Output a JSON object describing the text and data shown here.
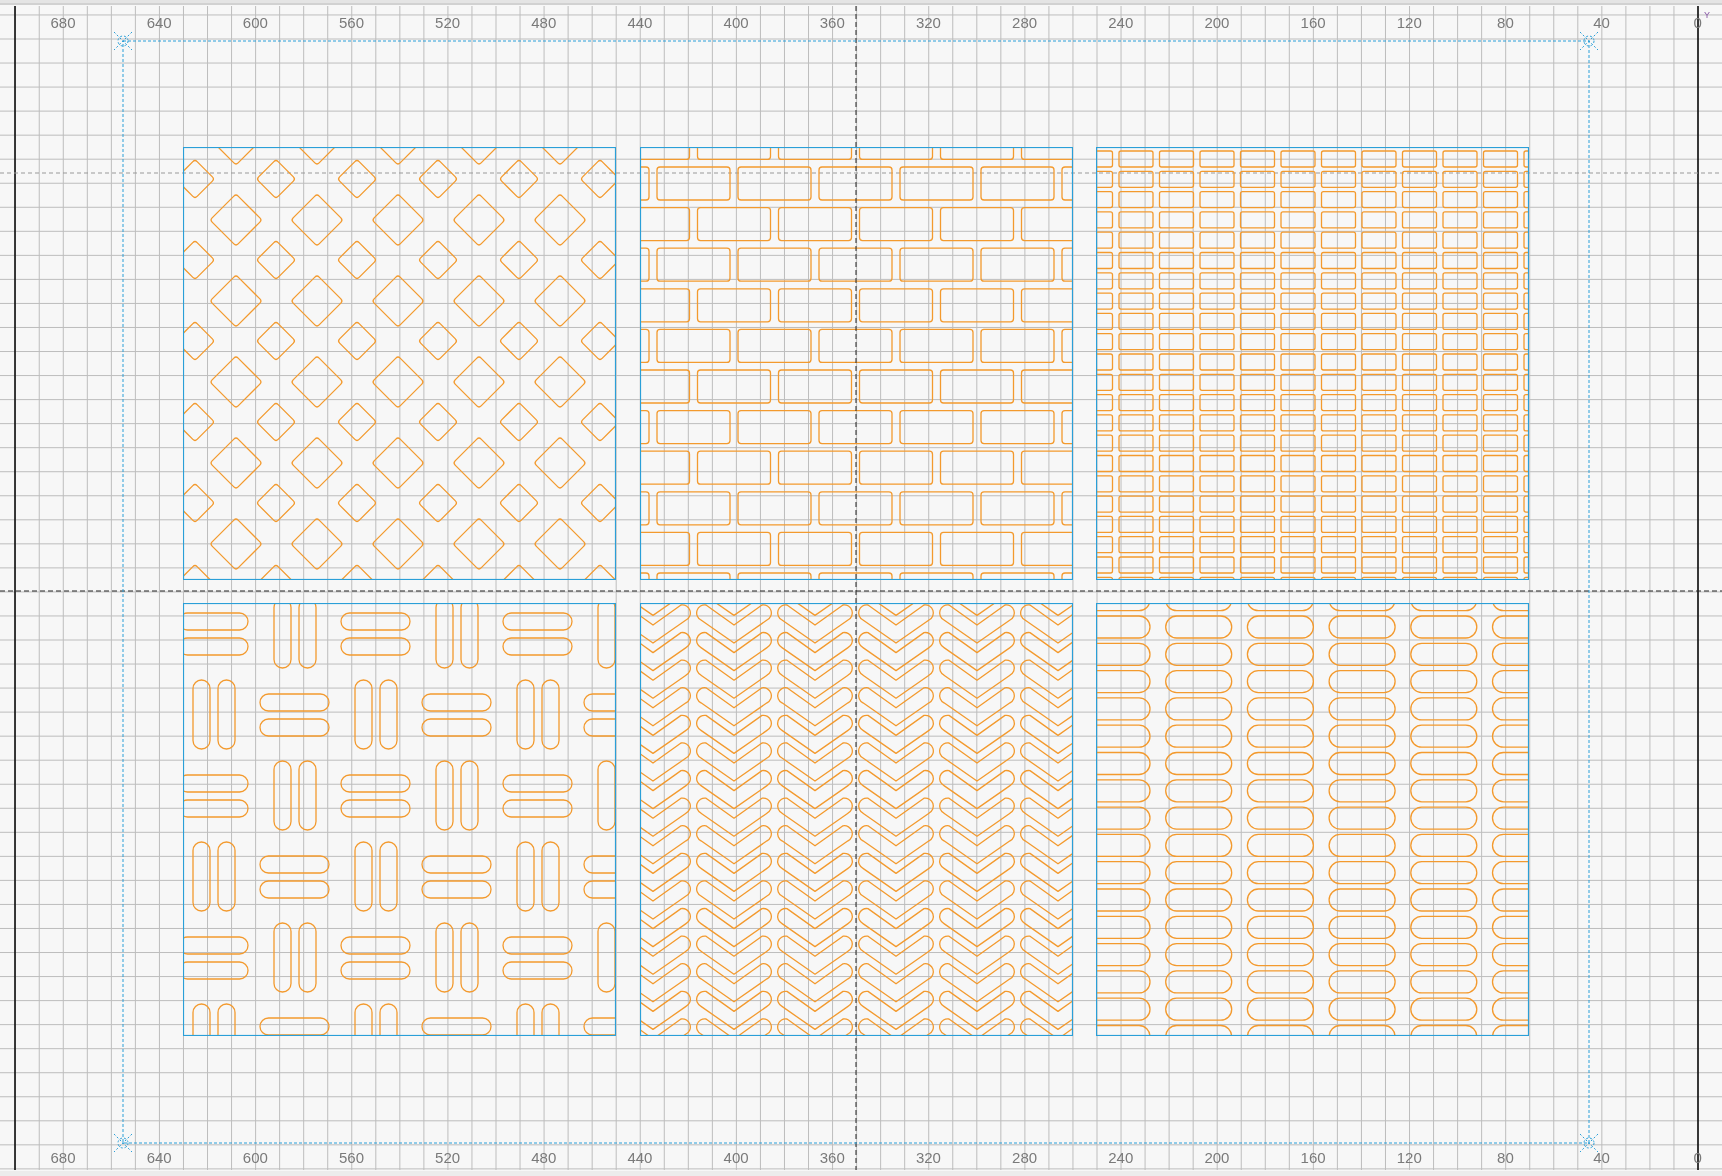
{
  "rulers": {
    "top": {
      "labels": [
        "680",
        "640",
        "600",
        "560",
        "520",
        "480",
        "440",
        "400",
        "360",
        "320",
        "280",
        "240",
        "200",
        "160",
        "120",
        "80",
        "40",
        "0"
      ]
    },
    "bottom": {
      "labels": [
        "680",
        "640",
        "600",
        "560",
        "520",
        "480",
        "440",
        "400",
        "360",
        "320",
        "280",
        "240",
        "200",
        "160",
        "120",
        "80",
        "40",
        "0"
      ]
    }
  },
  "axis_label": "Y",
  "tiles": [
    {
      "kind": "diamonds"
    },
    {
      "kind": "bricks"
    },
    {
      "kind": "small-bricks"
    },
    {
      "kind": "basketweave"
    },
    {
      "kind": "chevrons"
    },
    {
      "kind": "pills"
    }
  ]
}
